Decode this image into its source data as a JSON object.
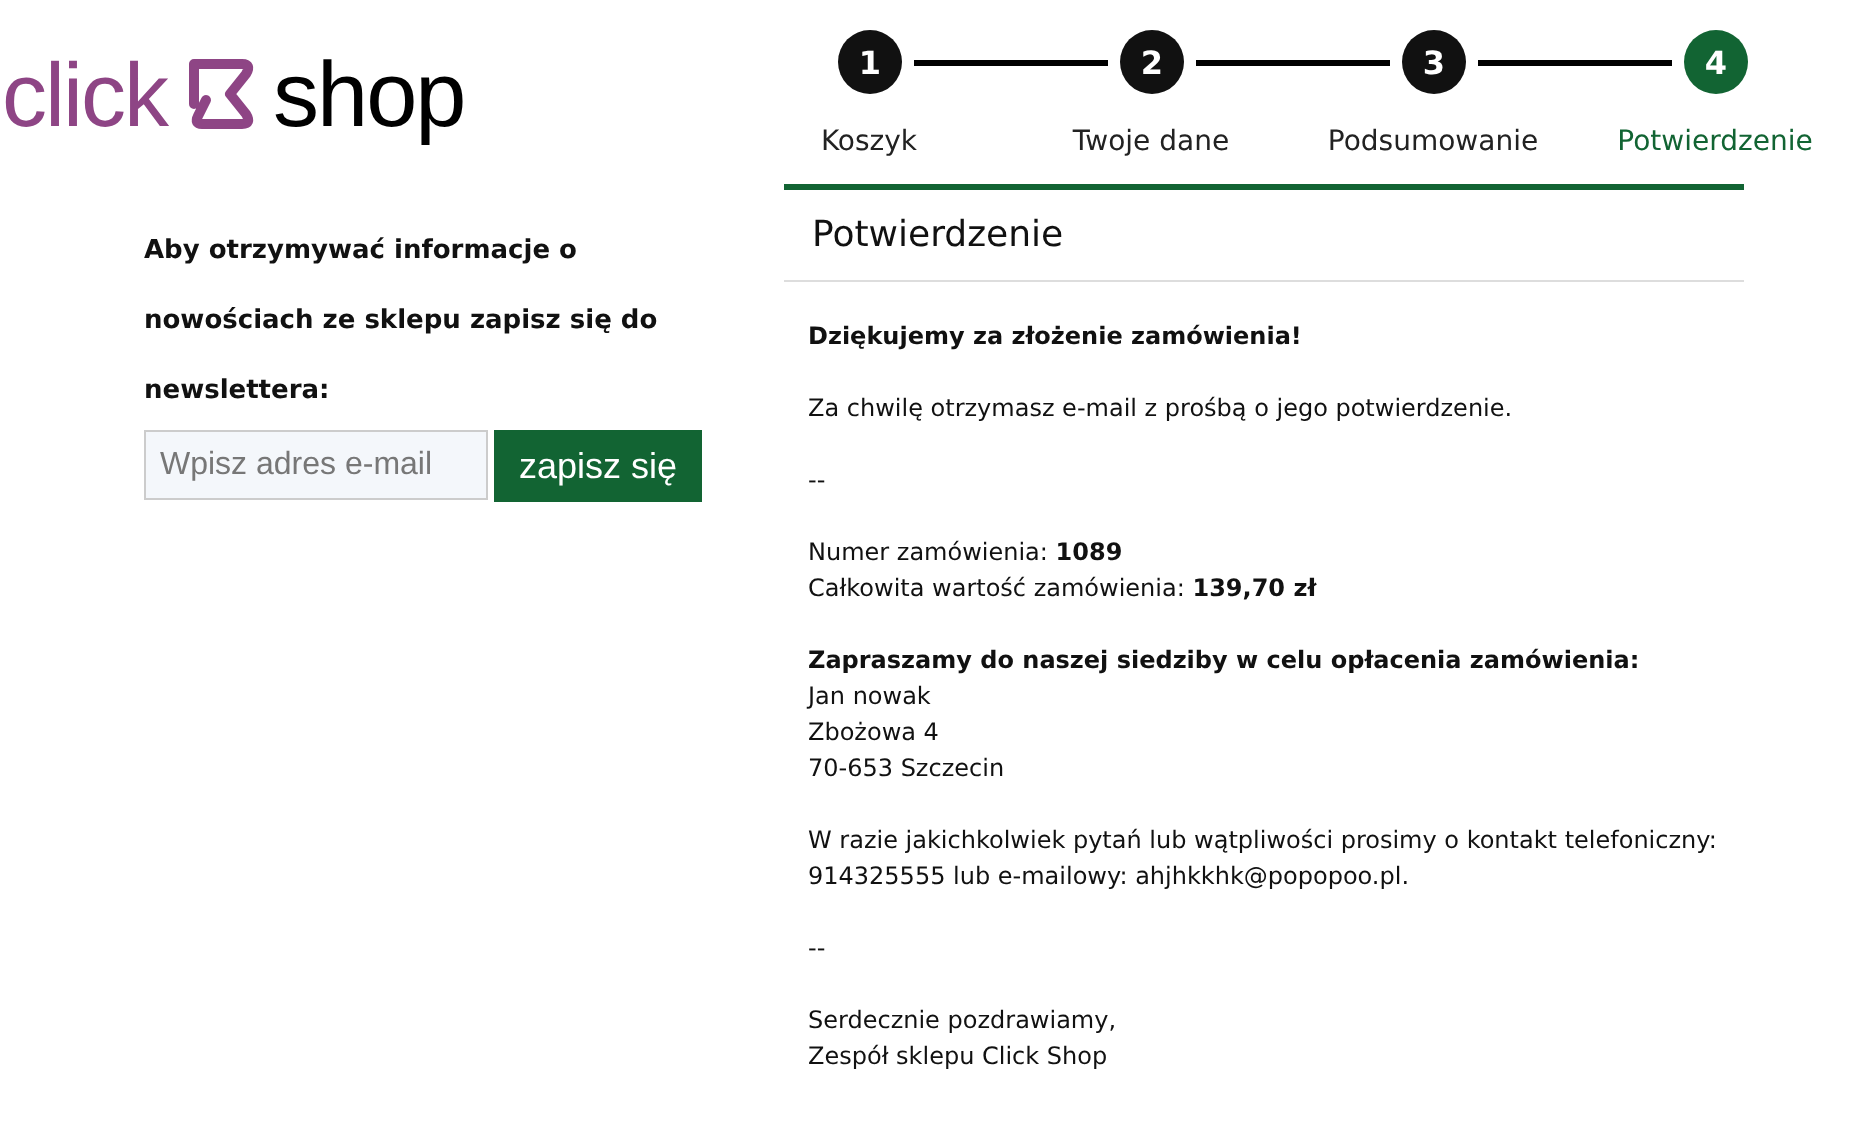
{
  "logo": {
    "brand_part": "click",
    "shop_part": "shop"
  },
  "steps": [
    {
      "number": "1",
      "label": "Koszyk",
      "selected": false
    },
    {
      "number": "2",
      "label": "Twoje dane",
      "selected": false
    },
    {
      "number": "3",
      "label": "Podsumowanie",
      "selected": false
    },
    {
      "number": "4",
      "label": "Potwierdzenie",
      "selected": true
    }
  ],
  "newsletter": {
    "text": "Aby otrzymywać informacje o nowościach ze sklepu zapisz się do newslettera:",
    "placeholder": "Wpisz adres e-mail",
    "button": "zapisz się"
  },
  "section_title": "Potwierdzenie",
  "message": [
    {
      "lines": [
        {
          "kind": "heading",
          "text": "Dziękujemy za złożenie zamówienia!"
        }
      ]
    },
    {
      "lines": [
        {
          "kind": "text",
          "text": "Za chwilę otrzymasz e-mail z prośbą o jego potwierdzenie."
        }
      ]
    },
    {
      "lines": [
        {
          "kind": "text",
          "text": "--"
        }
      ]
    },
    {
      "lines": [
        {
          "kind": "text",
          "text": "Numer zamówienia: **1089**"
        },
        {
          "kind": "text",
          "text": "Całkowita wartość zamówienia: **139,70 zł**"
        }
      ]
    },
    {
      "lines": [
        {
          "kind": "heading",
          "text": "Zapraszamy do naszej siedziby w celu opłacenia zamówienia:"
        },
        {
          "kind": "text",
          "text": "Jan nowak"
        },
        {
          "kind": "text",
          "text": "Zbożowa 4"
        },
        {
          "kind": "text",
          "text": "70-653 Szczecin"
        }
      ]
    },
    {
      "lines": [
        {
          "kind": "text",
          "text": "W razie jakichkolwiek pytań lub wątpliwości prosimy o kontakt telefoniczny:"
        },
        {
          "kind": "text",
          "text": "914325555 lub e-mailowy: ahjhkkhk@popopoo.pl."
        }
      ]
    },
    {
      "lines": [
        {
          "kind": "text",
          "text": "--"
        }
      ]
    },
    {
      "lines": [
        {
          "kind": "text",
          "text": "Serdecznie pozdrawiamy,"
        },
        {
          "kind": "text",
          "text": "Zespół sklepu Click Shop"
        }
      ]
    }
  ]
}
